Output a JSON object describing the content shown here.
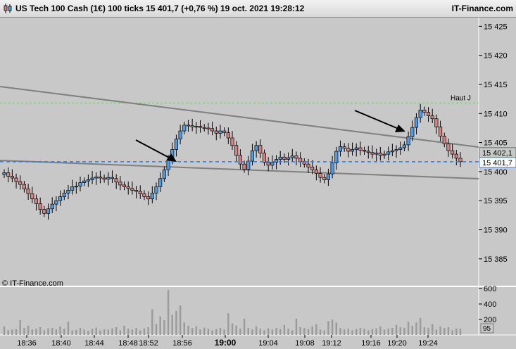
{
  "header": {
    "title": "US Tech 100 Cash (1€) 100 ticks 15 401,7 (+0,76 %) 19 oct. 2021 19:28:12",
    "brand": "IT-Finance.com",
    "icon": "candlestick-icon"
  },
  "watermark": "© IT-Finance.com",
  "colors": {
    "background": "#c8c8c8",
    "bull": "#4f9be6",
    "bear": "#d98080",
    "price_line": "#2a7fff",
    "haut_line": "#66cc66",
    "trend_line": "#808080"
  },
  "chart_data": {
    "type": "candlestick",
    "instrument": "US Tech 100 Cash (1€)",
    "timeframe": "100 ticks",
    "last_price": "15 401,7",
    "change": "+0,76 %",
    "date": "19 oct. 2021 19:28:12",
    "x_tick_labels": [
      "18:36",
      "18:40",
      "18:44",
      "18:48",
      "18:52",
      "18:56",
      "19:00",
      "19:04",
      "19:08",
      "19:12",
      "19:16",
      "19:20",
      "19:24"
    ],
    "bold_x_tick": "19:00",
    "y_tick_labels": [
      "15 425",
      "15 420",
      "15 415",
      "15 410",
      "15 405",
      "15 400",
      "15 395",
      "15 390",
      "15 385"
    ],
    "ylim": [
      15380.5,
      15426.5
    ],
    "price_labels": {
      "upper": "15 402,1",
      "current": "15 401,7"
    },
    "haut_label": "Haut J",
    "haut_value": 15411.8,
    "closes": [
      15399.8,
      15399.2,
      15398.9,
      15398.3,
      15397.8,
      15397.0,
      15396.2,
      15395.3,
      15394.5,
      15393.5,
      15392.8,
      15393.6,
      15394.4,
      15395.0,
      15395.7,
      15396.3,
      15396.8,
      15397.4,
      15397.5,
      15398.1,
      15398.4,
      15398.6,
      15398.9,
      15399.1,
      15398.9,
      15398.7,
      15399.0,
      15398.8,
      15398.2,
      15397.7,
      15397.4,
      15397.1,
      15396.8,
      15396.6,
      15396.2,
      15395.7,
      15395.3,
      15396.3,
      15397.4,
      15398.8,
      15400.3,
      15402.0,
      15403.8,
      15405.6,
      15407.0,
      15408.0,
      15407.9,
      15407.7,
      15407.8,
      15407.6,
      15407.5,
      15407.4,
      15407.0,
      15406.6,
      15407.0,
      15406.7,
      15405.8,
      15404.5,
      15402.8,
      15401.3,
      15400.4,
      15401.8,
      15403.6,
      15404.5,
      15403.2,
      15401.6,
      15401.1,
      15401.6,
      15402.1,
      15402.5,
      15402.1,
      15402.4,
      15402.7,
      15402.3,
      15401.7,
      15401.3,
      15400.8,
      15400.3,
      15399.7,
      15399.0,
      15398.6,
      15399.6,
      15401.5,
      15403.5,
      15404.3,
      15404.0,
      15403.5,
      15403.8,
      15404.1,
      15403.7,
      15403.5,
      15403.3,
      15403.0,
      15403.2,
      15402.8,
      15403.0,
      15403.4,
      15403.6,
      15403.8,
      15404.1,
      15404.6,
      15406.0,
      15407.6,
      15409.3,
      15410.6,
      15410.2,
      15409.6,
      15409.1,
      15407.7,
      15406.1,
      15404.8,
      15403.6,
      15403.0,
      15402.3,
      15401.7
    ],
    "volume_ticks": [
      "600",
      "400",
      "200"
    ],
    "volume_extra_label": "95",
    "volumes": [
      110,
      60,
      70,
      75,
      190,
      90,
      120,
      70,
      80,
      100,
      60,
      85,
      90,
      70,
      110,
      80,
      170,
      60,
      65,
      90,
      70,
      55,
      80,
      95,
      60,
      75,
      70,
      85,
      100,
      60,
      120,
      80,
      70,
      90,
      60,
      85,
      100,
      330,
      140,
      240,
      190,
      580,
      260,
      310,
      380,
      160,
      120,
      90,
      110,
      70,
      95,
      80,
      60,
      75,
      90,
      70,
      280,
      150,
      120,
      80,
      210,
      90,
      70,
      110,
      80,
      60,
      85,
      70,
      90,
      75,
      130,
      80,
      60,
      210,
      100,
      90,
      75,
      110,
      140,
      70,
      60,
      180,
      200,
      160,
      90,
      70,
      80,
      60,
      75,
      90,
      80,
      60,
      75,
      85,
      110,
      70,
      80,
      90,
      130,
      100,
      90,
      170,
      120,
      160,
      220,
      100,
      90,
      140,
      70,
      110,
      90,
      100,
      60,
      85,
      80
    ]
  }
}
